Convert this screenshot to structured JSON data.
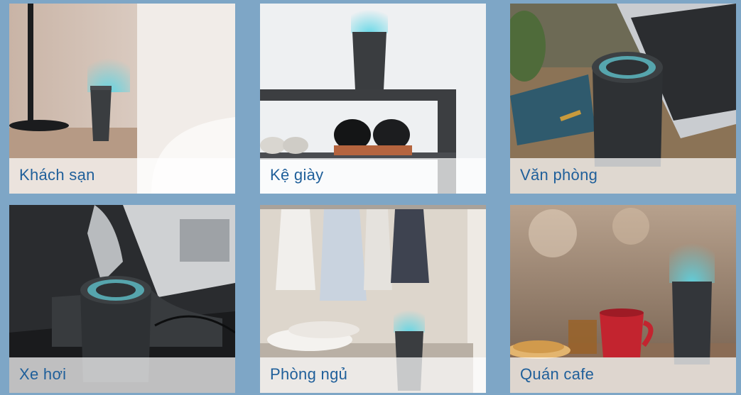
{
  "tiles": [
    {
      "label": "Khách sạn"
    },
    {
      "label": "Kệ giày"
    },
    {
      "label": "Văn phòng"
    },
    {
      "label": "Xe hơi"
    },
    {
      "label": "Phòng ngủ"
    },
    {
      "label": "Quán cafe"
    }
  ],
  "colors": {
    "background": "#7ea6c6",
    "caption_text": "#1f5f9a",
    "device": "#3a3d40",
    "ion_glow": "#5ad6e6"
  }
}
